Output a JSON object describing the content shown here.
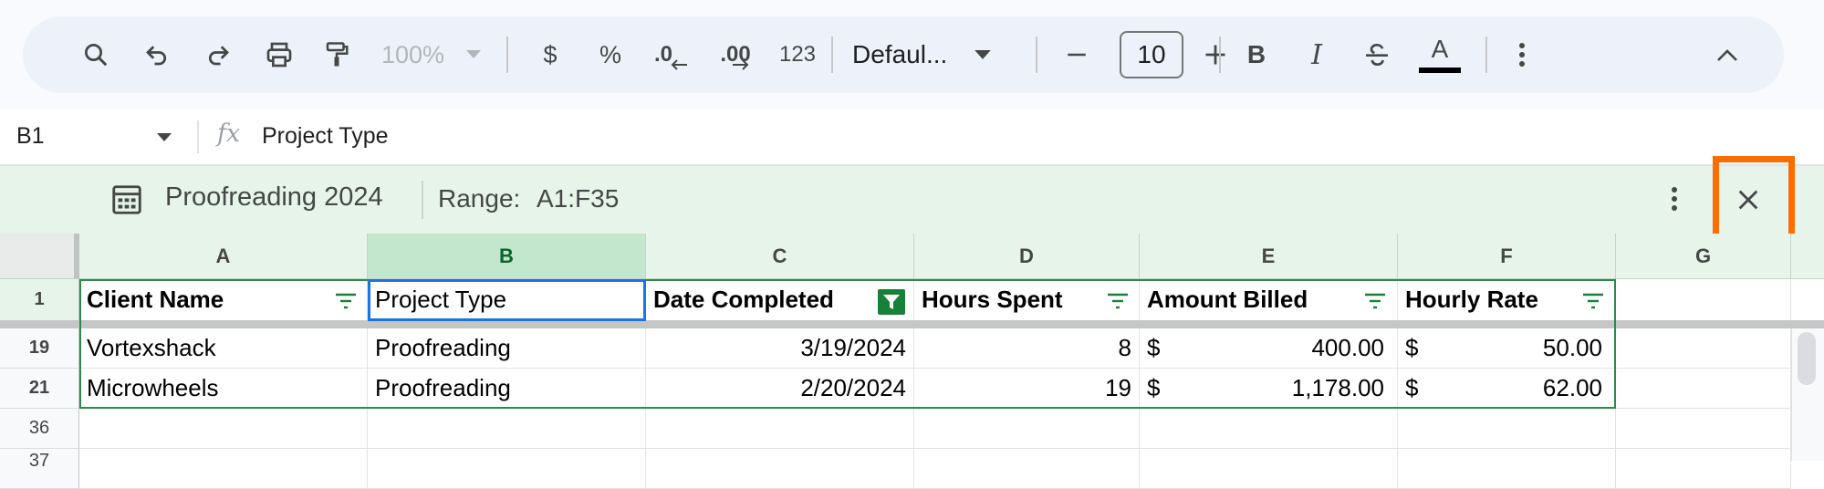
{
  "toolbar": {
    "zoom": "100%",
    "currency_label": "$",
    "percent_label": "%",
    "decrease_decimal_label": ".0",
    "increase_decimal_label": ".00",
    "number_format_label": "123",
    "font_name": "Defaul...",
    "font_size": "10",
    "bold_label": "B",
    "italic_label": "I",
    "text_color_label": "A"
  },
  "formula_bar": {
    "cell_ref": "B1",
    "fx_label": "fx",
    "formula": "Project Type"
  },
  "filter_view": {
    "name": "Proofreading 2024",
    "range_label": "Range:",
    "range_value": "A1:F35"
  },
  "grid": {
    "columns": [
      "A",
      "B",
      "C",
      "D",
      "E",
      "F",
      "G"
    ],
    "selected_column": "B",
    "header_row": {
      "row_number": "1",
      "cells": [
        "Client Name",
        "Project Type",
        "Date Completed",
        "Hours Spent",
        "Amount Billed",
        "Hourly Rate"
      ]
    },
    "rows": [
      {
        "row_number": "19",
        "client": "Vortexshack",
        "project": "Proofreading",
        "date": "3/19/2024",
        "hours": "8",
        "amount_symbol": "$",
        "amount": "400.00",
        "rate_symbol": "$",
        "rate": "50.00"
      },
      {
        "row_number": "21",
        "client": "Microwheels",
        "project": "Proofreading",
        "date": "2/20/2024",
        "hours": "19",
        "amount_symbol": "$",
        "amount": "1,178.00",
        "rate_symbol": "$",
        "rate": "62.00"
      },
      {
        "row_number": "36"
      },
      {
        "row_number": "37"
      }
    ]
  },
  "colors": {
    "filter_bar_bg": "#e6f4ea",
    "selected_col_header": "#c2e7cc",
    "active_cell_border": "#1a73e8",
    "highlight_border": "#ff6d00",
    "filter_active_icon": "#188038"
  }
}
